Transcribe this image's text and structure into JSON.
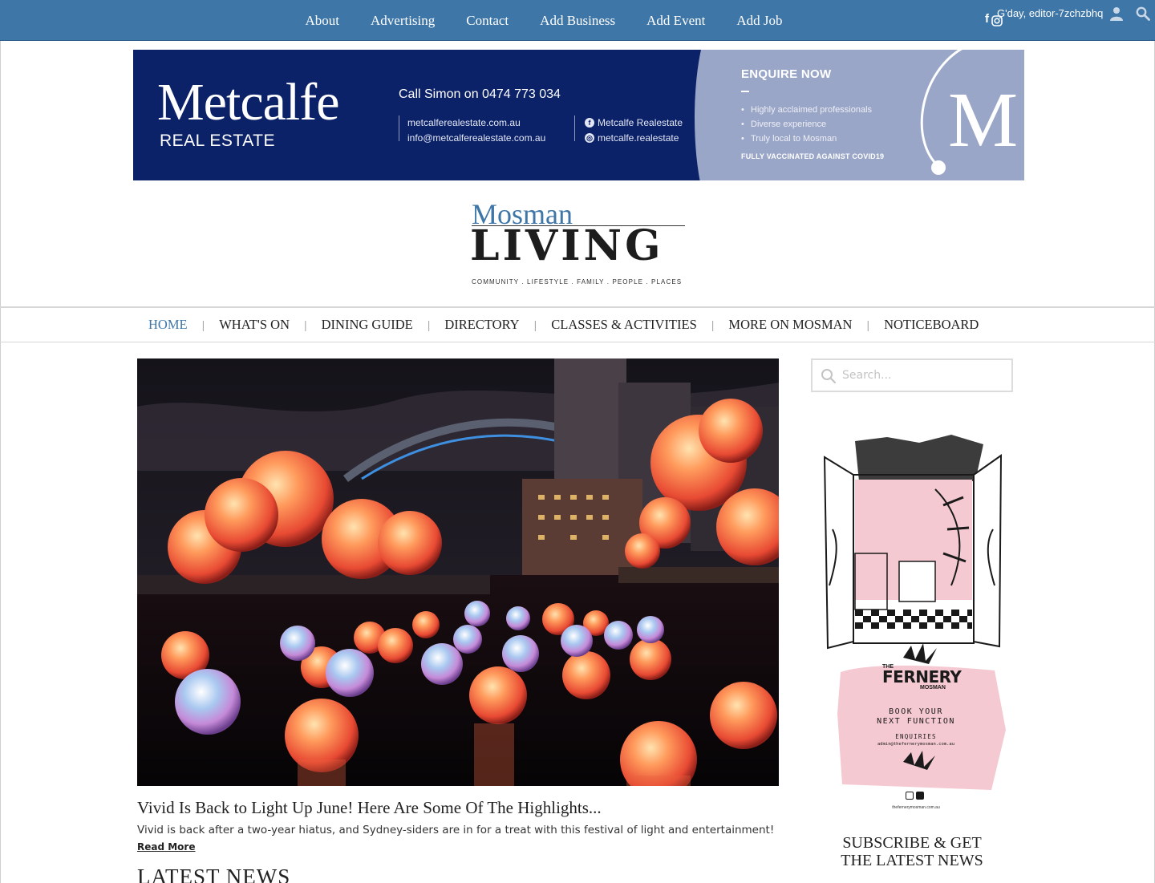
{
  "topbar": {
    "nav": [
      "About",
      "Advertising",
      "Contact",
      "Add Business",
      "Add Event",
      "Add Job"
    ],
    "social_icons": [
      "facebook-icon",
      "instagram-icon"
    ],
    "greeting": "G'day, editor-7zchzbhq",
    "icons": [
      "user-icon",
      "search-icon"
    ],
    "background": "#3e76a7"
  },
  "banner": {
    "brand": "Metcalfe",
    "brand_sub": "REAL ESTATE",
    "call": "Call Simon on 0474 773 034",
    "website": "metcalferealestate.com.au",
    "email": "info@metcalferealestate.com.au",
    "facebook": "Metcalfe Realestate",
    "instagram": "metcalfe.realestate",
    "enquire": "ENQUIRE NOW",
    "points": [
      "Highly acclaimed professionals",
      "Diverse experience",
      "Truly local to Mosman"
    ],
    "vaccinated": "FULLY VACCINATED AGAINST COVID19",
    "monogram": "M",
    "colors": {
      "navy": "#0c2268",
      "lavender": "#9aa6c7"
    }
  },
  "logo": {
    "line1": "Mosman",
    "line2": "LIVING",
    "tagline": "COMMUNITY . LIFESTYLE . FAMILY . PEOPLE . PLACES"
  },
  "mainnav": {
    "items": [
      "HOME",
      "WHAT'S ON",
      "DINING GUIDE",
      "DIRECTORY",
      "CLASSES & ACTIVITIES",
      "MORE ON MOSMAN",
      "NOTICEBOARD"
    ],
    "active": "HOME",
    "separator": "|"
  },
  "feature": {
    "title": "Vivid Is Back to Light Up June! Here Are Some Of The Highlights...",
    "excerpt": "Vivid is back after a two-year hiatus, and Sydney-siders are in for a treat with this festival of light and entertainment!",
    "read_more": "Read More",
    "image": "vivid-sydney-glowing-spheres-harbour-bridge"
  },
  "sections": {
    "latest_news": "LATEST NEWS"
  },
  "sidebar": {
    "search_placeholder": "Search...",
    "ad": {
      "the": "THE",
      "name": "FERNERY",
      "suburb": "MOSMAN",
      "line1": "BOOK YOUR",
      "line2": "NEXT FUNCTION",
      "enquiries": "ENQUIRIES",
      "email": "admin@thefernerymosman.com.au",
      "url": "thefernerymosman.com.au",
      "colors": {
        "pink": "#f5c9d1"
      }
    },
    "subscribe": "SUBSCRIBE & GET THE LATEST NEWS"
  }
}
